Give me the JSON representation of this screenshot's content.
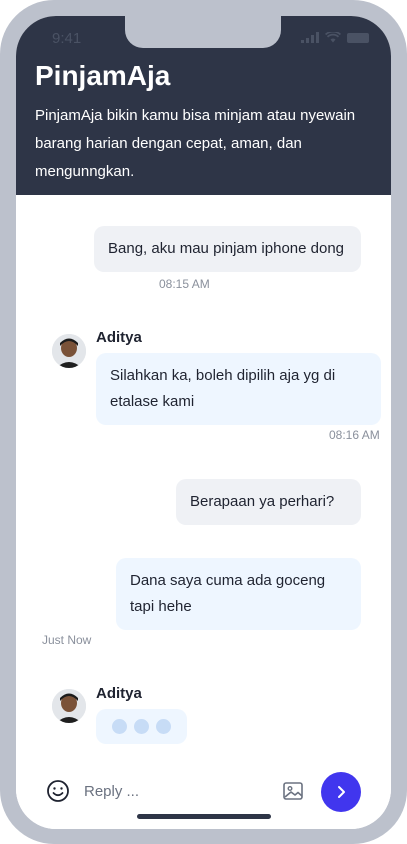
{
  "status_bar": {
    "time": "9:41"
  },
  "header": {
    "title": "PinjamAja",
    "description": " PinjamAja bikin kamu bisa minjam atau nyewain barang harian dengan cepat, aman, dan mengunngkan."
  },
  "messages": [
    {
      "direction": "out",
      "text": "Bang, aku mau pinjam iphone dong",
      "time": "08:15 AM"
    },
    {
      "direction": "in",
      "sender": "Aditya",
      "text": "Silahkan ka, boleh dipilih aja yg di etalase kami",
      "time": "08:16 AM"
    },
    {
      "direction": "out",
      "text": "Berapaan ya perhari?"
    },
    {
      "direction": "out",
      "text": "Dana saya cuma ada goceng tapi hehe",
      "time": "Just Now"
    }
  ],
  "typing": {
    "sender": "Aditya"
  },
  "composer": {
    "placeholder": "Reply ..."
  },
  "colors": {
    "header_bg": "#2e3547",
    "accent": "#4136ee",
    "incoming_bubble": "#eef6ff",
    "outgoing_bubble": "#eff1f5"
  },
  "icons": [
    "smile-icon",
    "image-icon",
    "chevron-right-icon",
    "signal-icon",
    "wifi-icon",
    "battery-icon"
  ]
}
